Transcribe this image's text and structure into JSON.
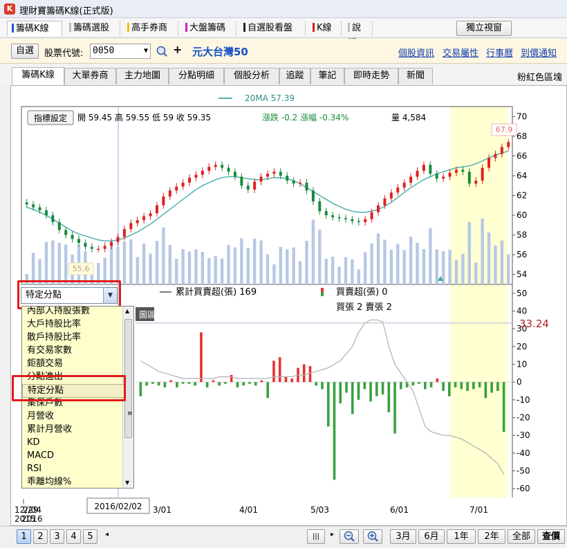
{
  "window": {
    "title": "理財寶籌碼K線(正式版)",
    "icon": "K"
  },
  "top_tabs": [
    {
      "label": "籌碼K線",
      "color": "#1a5ccc"
    },
    {
      "label": "籌碼選股",
      "color": "#bbbbbb"
    },
    {
      "label": "高手券商",
      "color": "#f0c000"
    },
    {
      "label": "大盤籌碼",
      "color": "#d020d0"
    },
    {
      "label": "自選股看盤",
      "color": "#222222"
    },
    {
      "label": "K線",
      "color": "#e01a1a"
    },
    {
      "label": "說明",
      "color": "#bbbbbb"
    }
  ],
  "detach_button": "獨立視窗",
  "stock_row": {
    "watchlist_button": "自選",
    "code_label": "股票代號:",
    "code_value": "0050",
    "stock_name": "元大台灣50",
    "links": [
      "個股資訊",
      "交易屬性",
      "行事曆",
      "到價通知"
    ]
  },
  "sub_tabs": [
    "籌碼K線",
    "大單券商",
    "主力地圖",
    "分點明細",
    "個股分析",
    "追蹤",
    "筆記",
    "即時走勢",
    "新聞"
  ],
  "area_label": "粉紅色區塊",
  "chart_header": {
    "ma_legend": "20MA 57.39",
    "indicator_button": "指標設定",
    "ohlc": "開 59.45  高 59.55  低 59  收 59.35",
    "change": "漲跌 -0.2  漲幅  -0.34%",
    "volume": "量 4,584",
    "last_price_label": "67.9",
    "low_price_label": "55.6"
  },
  "dropdown": {
    "selected": "特定分點",
    "items": [
      "內部人持股張數",
      "大戶持股比率",
      "散戶持股比率",
      "有交易家數",
      "鉅額交易",
      "分點進出",
      "特定分點",
      "集保戶數",
      "月營收",
      "累計月營收",
      "KD",
      "MACD",
      "RSI",
      "乖離均線%"
    ],
    "selected_index": 6
  },
  "lower_panel": {
    "legend_cum": "累計買賣超(張) 169",
    "legend_net": "買賣超(張) 0",
    "legend_counts": "買張 2 賣張 2",
    "partial_label": "圖區",
    "hline_label": "33.24"
  },
  "x_axis": [
    "12/29",
    "2/04",
    "2015",
    "2016",
    "3/01",
    "4/01",
    "5/03",
    "6/01",
    "7/01"
  ],
  "date_readout": "2016/02/02",
  "bottom_bar": {
    "pages": [
      "1",
      "2",
      "3",
      "4",
      "5"
    ],
    "active_page": "1",
    "ranges": [
      "3月",
      "6月",
      "1年",
      "2年",
      "全部"
    ],
    "query_button": "查價"
  },
  "chart_data": [
    {
      "type": "candlestick",
      "y_axis": {
        "ticks": [
          54,
          56,
          58,
          60,
          62,
          64,
          66,
          68,
          70
        ],
        "ylim": [
          53,
          71
        ]
      },
      "series": [
        {
          "name": "20MA",
          "values": [
            60.8,
            60.6,
            60.3,
            60.0,
            59.6,
            59.2,
            58.8,
            58.4,
            58.1,
            57.9,
            57.7,
            57.5,
            57.4,
            57.4,
            57.5,
            57.7,
            58.0,
            58.3,
            58.7,
            59.1,
            59.6,
            60.1,
            60.6,
            61.1,
            61.6,
            62.1,
            62.6,
            63.0,
            63.3,
            63.6,
            63.8,
            63.9,
            63.9,
            63.8,
            63.7,
            63.6,
            63.6,
            63.7,
            63.8,
            63.8,
            63.7,
            63.5,
            63.2,
            62.8,
            62.4,
            62.0,
            61.6,
            61.2,
            60.9,
            60.6,
            60.4,
            60.3,
            60.3,
            60.4,
            60.6,
            60.9,
            61.3,
            61.8,
            62.3,
            62.8,
            63.2,
            63.6,
            63.9,
            64.2,
            64.4,
            64.6,
            64.8,
            64.9,
            65.0,
            65.2,
            65.5,
            65.8,
            66.1,
            66.3,
            66.5
          ]
        }
      ],
      "close": [
        61.1,
        60.8,
        60.5,
        60.0,
        59.3,
        58.5,
        58.0,
        57.6,
        57.2,
        56.8,
        56.6,
        56.6,
        56.9,
        57.3,
        57.8,
        58.6,
        59.2,
        59.5,
        59.9,
        60.2,
        61.0,
        61.9,
        62.5,
        62.9,
        63.3,
        63.8,
        64.1,
        64.5,
        64.9,
        65.1,
        64.8,
        64.4,
        63.9,
        63.0,
        62.6,
        63.4,
        63.9,
        64.2,
        64.4,
        64.0,
        63.5,
        63.2,
        63.3,
        62.5,
        61.4,
        60.4,
        60.0,
        59.8,
        59.7,
        59.6,
        59.4,
        59.3,
        59.6,
        60.3,
        61.0,
        61.7,
        62.3,
        62.8,
        63.3,
        63.9,
        64.5,
        65.1,
        64.2,
        63.7,
        63.9,
        64.3,
        64.6,
        64.4,
        63.2,
        63.5,
        64.8,
        65.8,
        66.2,
        66.9,
        67.4
      ]
    },
    {
      "type": "bar",
      "y_axis": {
        "ticks": [
          50,
          40,
          30,
          20,
          10,
          0,
          -10,
          -20,
          -30,
          -40,
          -50,
          -60
        ],
        "ylim": [
          -65,
          55
        ]
      },
      "series": [
        {
          "name": "累計買賣超(張)",
          "values": [
            12,
            10,
            8,
            6,
            5,
            4,
            3,
            2,
            2,
            2,
            2,
            2,
            2,
            3,
            3,
            3,
            2,
            2,
            2,
            2,
            2,
            2,
            3,
            3,
            3,
            3,
            4,
            4,
            5,
            6,
            7,
            8,
            10,
            12,
            16,
            20,
            28,
            33,
            35,
            35,
            34,
            20,
            10,
            5,
            0,
            -5,
            -15,
            -25,
            -28,
            -29,
            -30,
            -30,
            -31,
            -32,
            -34,
            -36,
            -38,
            -40,
            -43,
            -46,
            -52
          ]
        },
        {
          "name": "買賣超(張)",
          "values": [
            -8,
            -2,
            -1,
            -2,
            -3,
            1,
            -3,
            -1,
            -1,
            -2,
            28,
            -3,
            1,
            -2,
            -1,
            4,
            -3,
            -2,
            -1,
            -2,
            1,
            -9,
            12,
            14,
            3,
            2,
            8,
            10,
            9,
            -2,
            -4,
            -25,
            -55,
            -12,
            -6,
            -18,
            -10,
            -4,
            -11,
            -8,
            -7,
            -17,
            -29,
            -4,
            -3,
            -2,
            -1,
            -4,
            -3,
            2,
            -5,
            -8,
            -3,
            -4,
            -5,
            -4,
            -3,
            -9,
            -6,
            -5,
            -28
          ]
        }
      ]
    }
  ]
}
